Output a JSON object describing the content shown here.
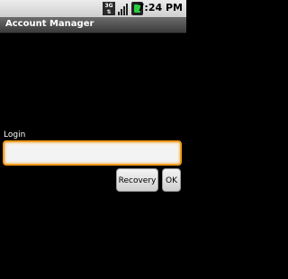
{
  "statusbar": {
    "network_label": "3G",
    "time": "7:24",
    "time_suffix": "PM"
  },
  "titlebar": {
    "title": "Account Manager"
  },
  "form": {
    "login_label": "Login",
    "login_value": ""
  },
  "buttons": {
    "recovery": "Recovery",
    "ok": "OK"
  }
}
